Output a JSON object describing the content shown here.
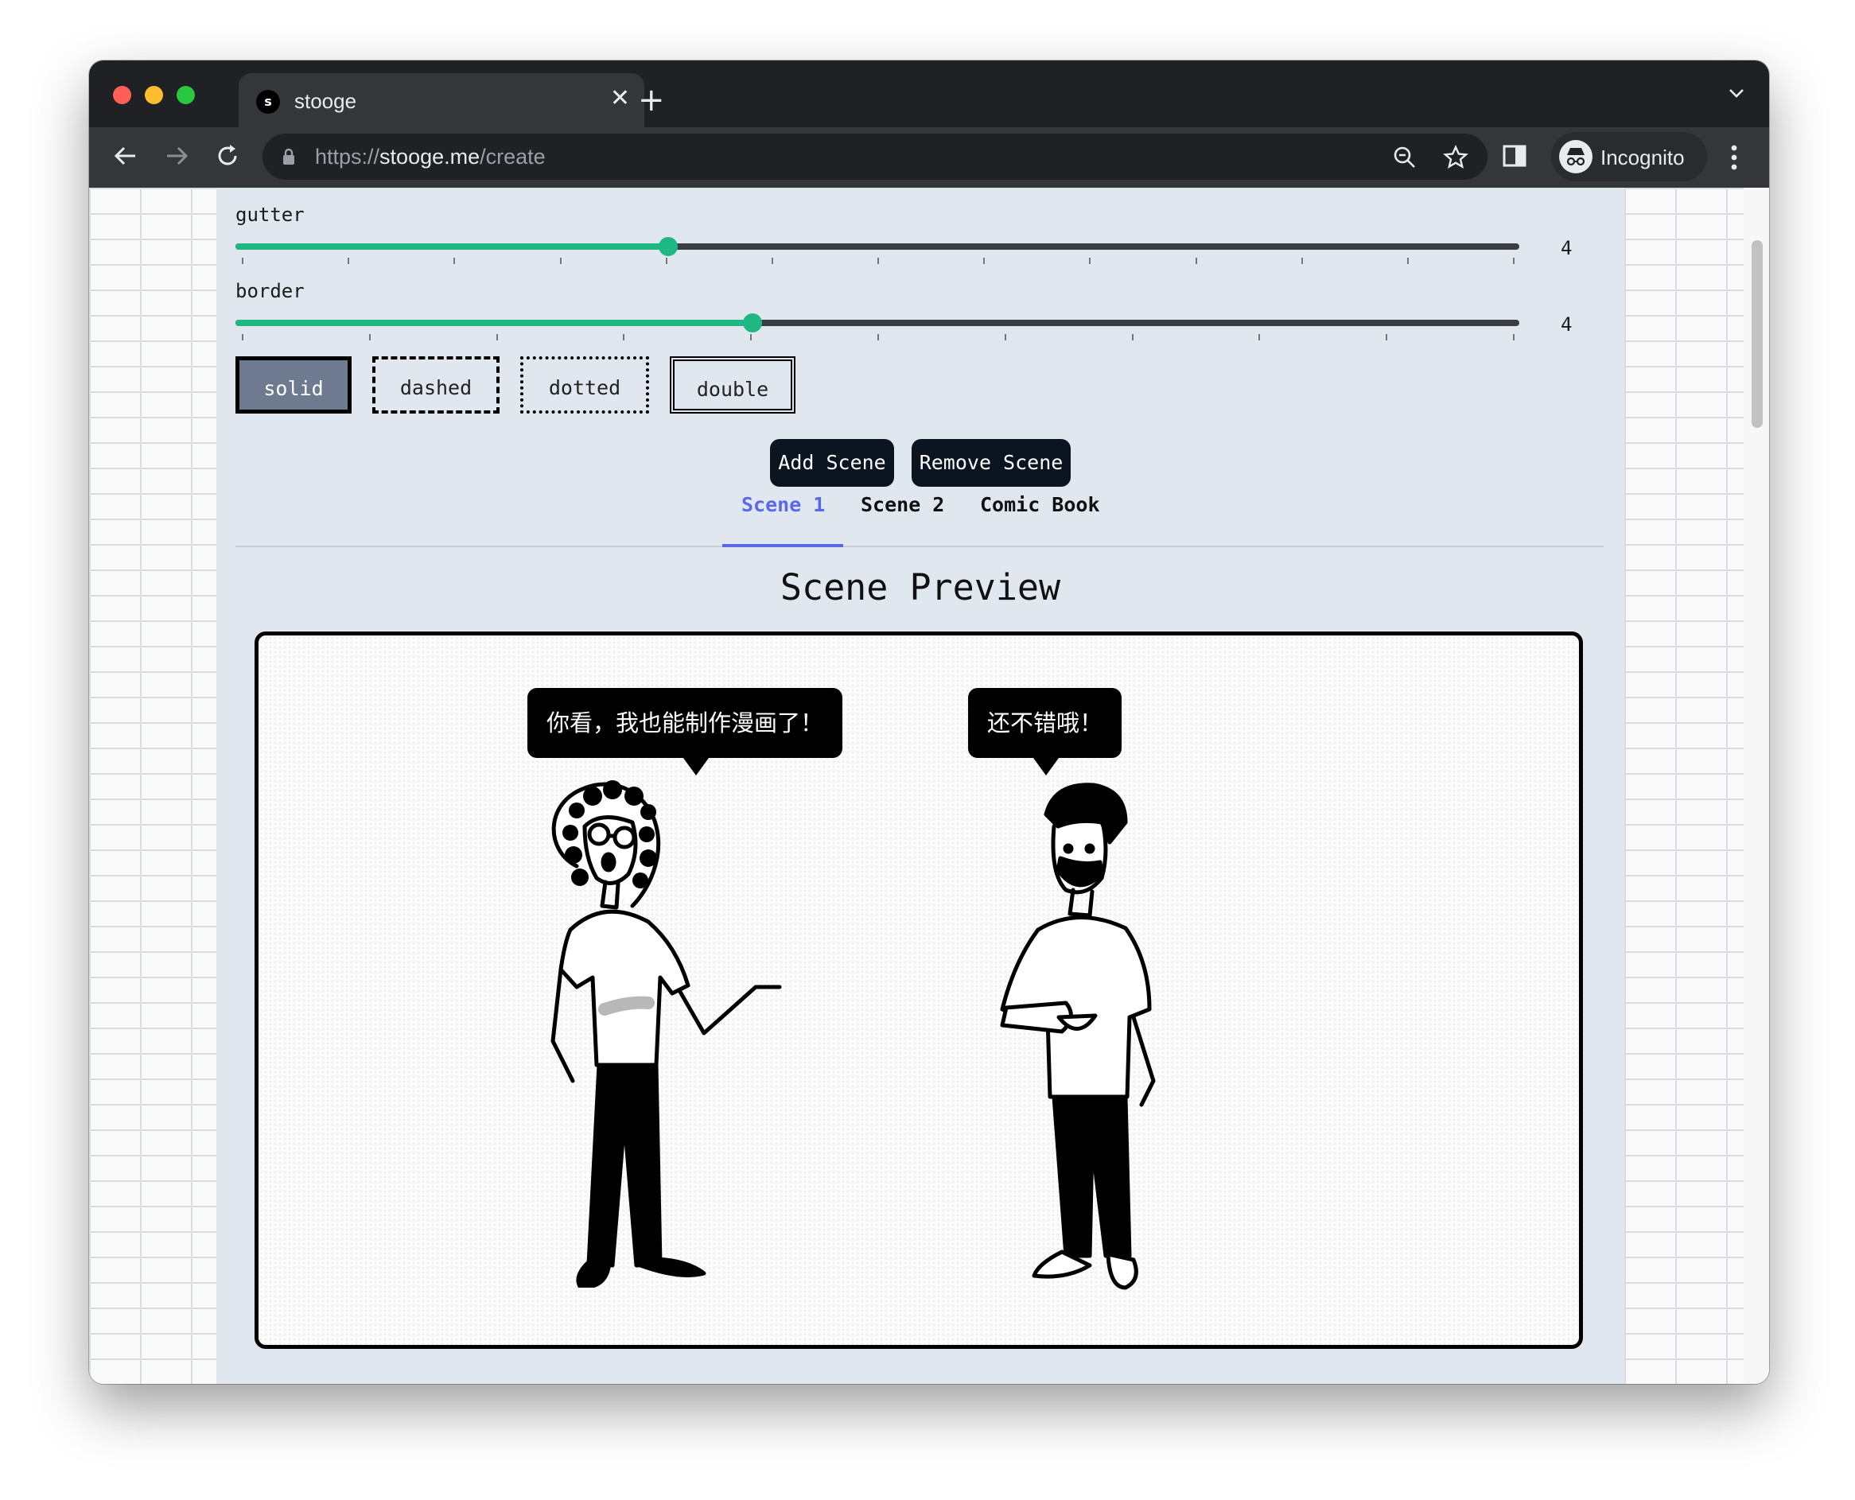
{
  "browser": {
    "tab_title": "stooge",
    "tab_favicon": "s",
    "url_scheme": "https://",
    "url_host": "stooge.me",
    "url_path": "/create",
    "profile_label": "Incognito",
    "traffic_colors": [
      "#ff5f57",
      "#febc2e",
      "#28c840"
    ]
  },
  "controls": {
    "gutter": {
      "label": "gutter",
      "value": "4",
      "fraction": 0.337,
      "ticks": 13
    },
    "border": {
      "label": "border",
      "value": "4",
      "fraction": 0.403,
      "ticks": 11
    },
    "border_styles": [
      {
        "label": "solid",
        "selected": true
      },
      {
        "label": "dashed",
        "selected": false
      },
      {
        "label": "dotted",
        "selected": false
      },
      {
        "label": "double",
        "selected": false
      }
    ],
    "add_scene": "Add Scene",
    "remove_scene": "Remove Scene"
  },
  "tabs": [
    {
      "label": "Scene 1",
      "active": true
    },
    {
      "label": "Scene 2",
      "active": false
    },
    {
      "label": "Comic Book",
      "active": false
    }
  ],
  "preview": {
    "title": "Scene Preview",
    "bubbles": [
      {
        "text": "你看，我也能制作漫画了！"
      },
      {
        "text": "还不错哦！"
      }
    ]
  },
  "colors": {
    "accent": "#1fb882",
    "active_tab": "#5b68e8",
    "selected_style": "#6d7a90",
    "button_dark": "#0b1522"
  }
}
